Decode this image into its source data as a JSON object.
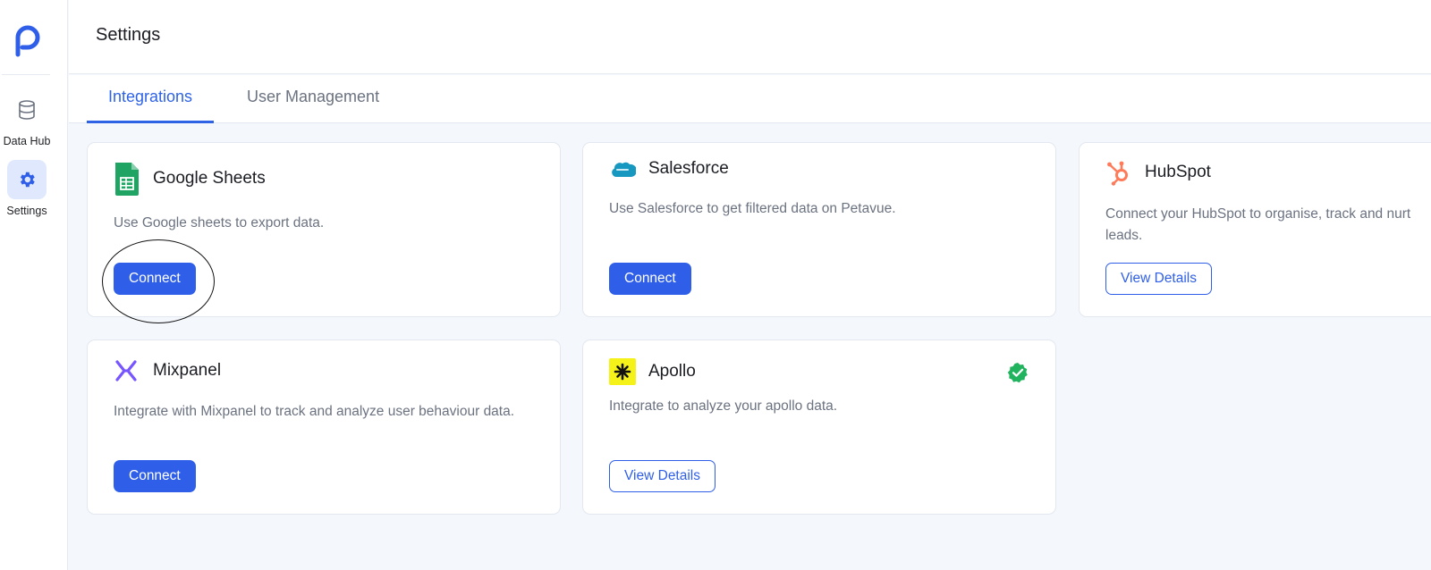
{
  "sidebar": {
    "logo": "petavue-logo",
    "items": [
      {
        "label": "Data Hub",
        "icon": "database-icon"
      },
      {
        "label": "Settings",
        "icon": "gear-icon"
      }
    ]
  },
  "header": {
    "title": "Settings"
  },
  "tabs": [
    {
      "label": "Integrations",
      "active": true
    },
    {
      "label": "User Management",
      "active": false
    }
  ],
  "integrations": [
    {
      "name": "Google Sheets",
      "description": "Use Google sheets to export data.",
      "action": "Connect",
      "icon": "google-sheets-icon"
    },
    {
      "name": "Salesforce",
      "description": "Use Salesforce to get filtered data on Petavue.",
      "action": "Connect",
      "icon": "salesforce-icon"
    },
    {
      "name": "HubSpot",
      "description": "Connect your HubSpot to organise, track and nurt leads.",
      "action": "View Details",
      "icon": "hubspot-icon"
    },
    {
      "name": "Mixpanel",
      "description": "Integrate with Mixpanel to track and analyze user behaviour data.",
      "action": "Connect",
      "icon": "mixpanel-icon"
    },
    {
      "name": "Apollo",
      "description": "Integrate to analyze your apollo data.",
      "action": "View Details",
      "icon": "apollo-icon",
      "connected": true
    }
  ],
  "colors": {
    "accent": "#2f5fe8",
    "active_nav_bg": "#dfe8fd",
    "connected_badge": "#22b35e",
    "background": "#f4f7fc"
  }
}
